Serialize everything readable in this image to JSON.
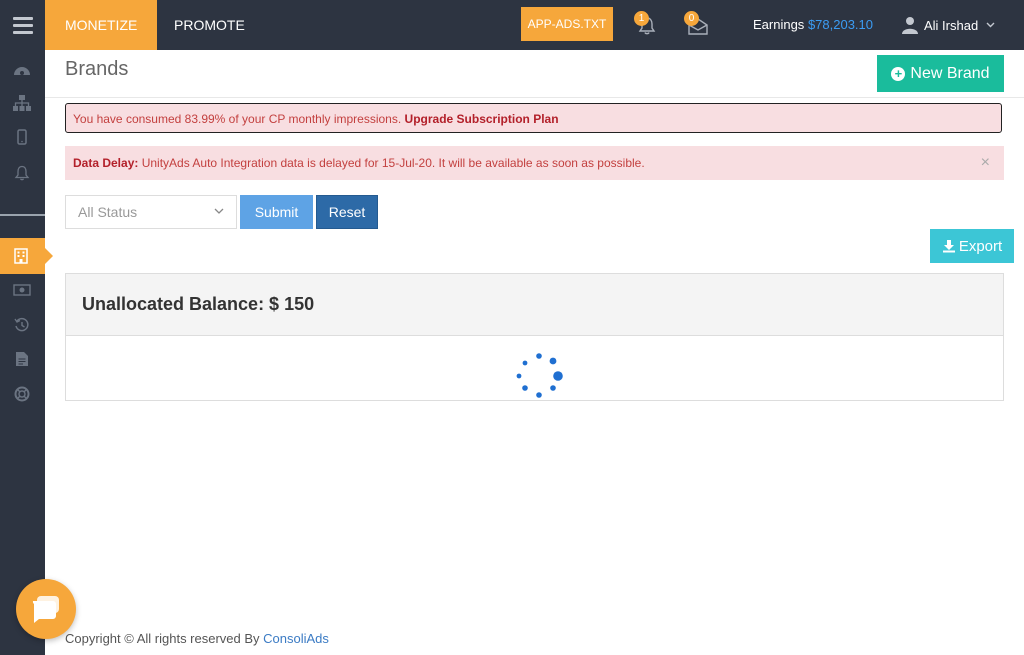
{
  "topbar": {
    "tabs": [
      {
        "label": "MONETIZE",
        "active": true
      },
      {
        "label": "PROMOTE",
        "active": false
      }
    ],
    "app_ads_label": "APP-ADS.TXT",
    "notifications": [
      {
        "icon": "bell-icon",
        "count": "1"
      },
      {
        "icon": "envelope-icon",
        "count": "0"
      }
    ],
    "earnings_label": "Earnings",
    "earnings_amount": "$78,203.10",
    "user_name": "Ali Irshad"
  },
  "sidebar": {
    "items": [
      {
        "icon": "dashboard-icon"
      },
      {
        "icon": "sitemap-icon"
      },
      {
        "icon": "mobile-icon"
      },
      {
        "icon": "bell-icon"
      },
      {
        "icon": "building-icon",
        "active": true
      },
      {
        "icon": "money-icon"
      },
      {
        "icon": "history-icon"
      },
      {
        "icon": "document-icon"
      },
      {
        "icon": "lifebuoy-icon"
      }
    ]
  },
  "page": {
    "title": "Brands",
    "new_brand_label": "New Brand"
  },
  "alerts": {
    "impressions_text": "You have consumed 83.99% of your CP monthly impressions. ",
    "impressions_link": "Upgrade Subscription Plan",
    "delay_label": "Data Delay:",
    "delay_text": " UnityAds Auto Integration data is delayed for 15-Jul-20. It will be available as soon as possible.",
    "close_symbol": "×"
  },
  "filters": {
    "status_value": "All Status",
    "submit_label": "Submit",
    "reset_label": "Reset",
    "export_label": "Export"
  },
  "panel": {
    "title": "Unallocated Balance: $ 150"
  },
  "footer": {
    "text": "Copyright © All rights reserved By ",
    "brand": "ConsoliAds"
  },
  "colors": {
    "topbar_bg": "#2d3441",
    "accent_orange": "#f6a73b",
    "new_brand_green": "#1abc9c",
    "submit_blue": "#5ea3e5",
    "reset_blue": "#2d6aa7",
    "export_cyan": "#3cc6d6",
    "alert_bg": "#f8dee1",
    "link_blue": "#3b9cf3"
  }
}
